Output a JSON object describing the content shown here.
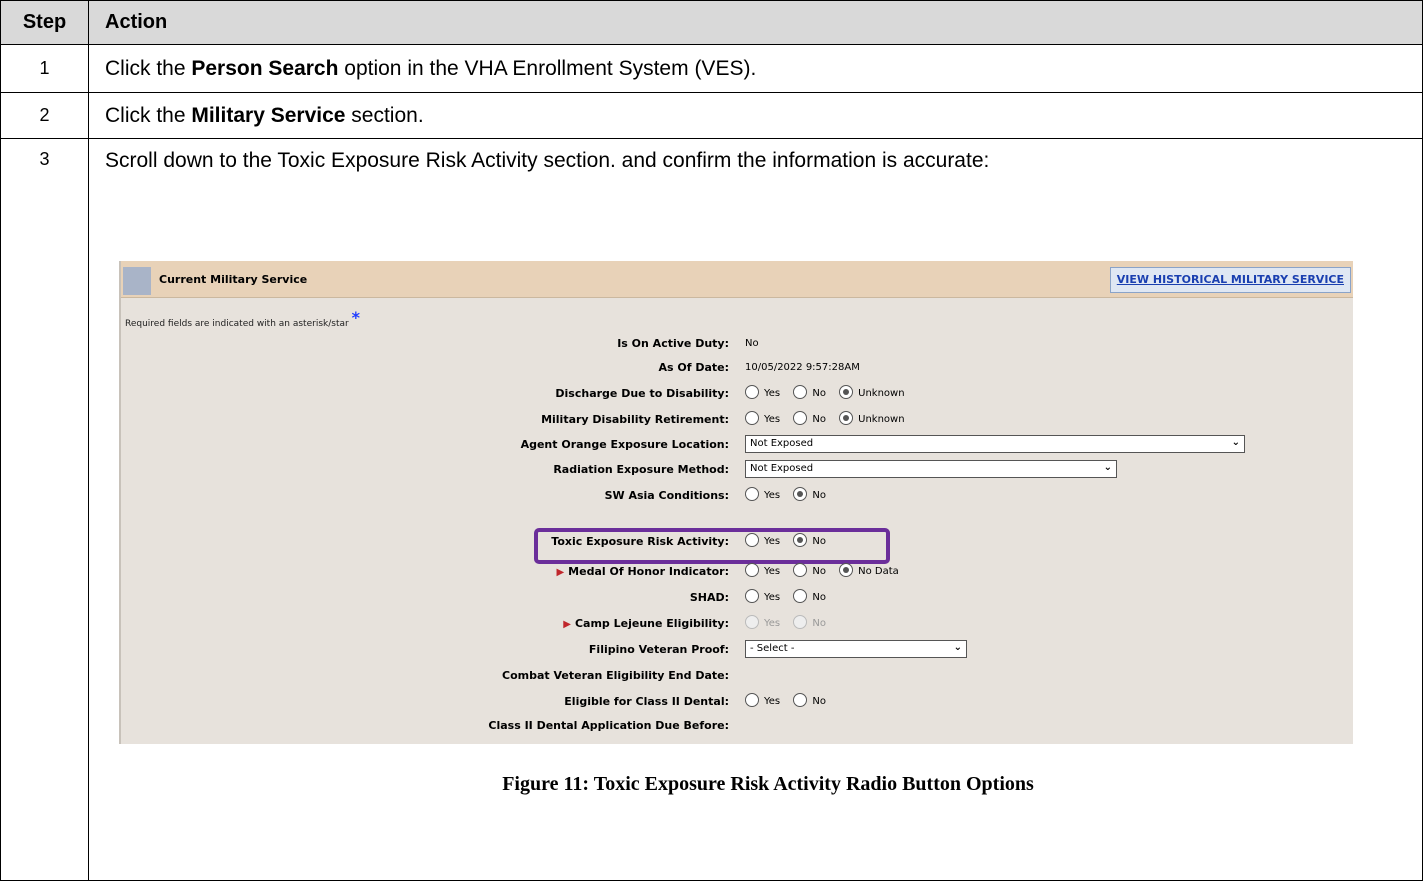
{
  "table": {
    "header_step": "Step",
    "header_action": "Action"
  },
  "rows": [
    {
      "step": "1",
      "pre": "Click the ",
      "bold": "Person Search",
      "post": " option in the VHA Enrollment System (VES)."
    },
    {
      "step": "2",
      "pre": "Click the ",
      "bold": "Military Service",
      "post": " section."
    },
    {
      "step": "3",
      "text": "Scroll down to the Toxic Exposure Risk Activity section. and confirm the information is accurate:"
    }
  ],
  "screenshot": {
    "title": "Current Military Service",
    "link": "VIEW HISTORICAL MILITARY SERVICE",
    "required_note": "Required fields are indicated with an asterisk/star",
    "required_star": "*",
    "fields": {
      "active_duty": {
        "label": "Is On Active Duty:",
        "value": "No"
      },
      "as_of_date": {
        "label": "As Of Date:",
        "value": "10/05/2022 9:57:28AM"
      },
      "discharge": {
        "label": "Discharge Due to Disability:",
        "options": [
          "Yes",
          "No",
          "Unknown"
        ],
        "selected": "Unknown"
      },
      "retirement": {
        "label": "Military Disability Retirement:",
        "options": [
          "Yes",
          "No",
          "Unknown"
        ],
        "selected": "Unknown"
      },
      "agent_orange": {
        "label": "Agent Orange Exposure Location:",
        "value": "Not Exposed"
      },
      "radiation": {
        "label": "Radiation Exposure Method:",
        "value": "Not Exposed"
      },
      "sw_asia": {
        "label": "SW Asia Conditions:",
        "options": [
          "Yes",
          "No"
        ],
        "selected": "No"
      },
      "toxic": {
        "label": "Toxic Exposure Risk Activity:",
        "options": [
          "Yes",
          "No"
        ],
        "selected": "No"
      },
      "medal": {
        "label": "Medal Of Honor Indicator:",
        "options": [
          "Yes",
          "No",
          "No Data"
        ],
        "selected": "No Data"
      },
      "shad": {
        "label": "SHAD:",
        "options": [
          "Yes",
          "No"
        ],
        "selected": ""
      },
      "lejeune": {
        "label": "Camp Lejeune Eligibility:",
        "options": [
          "Yes",
          "No"
        ],
        "selected": ""
      },
      "filipino": {
        "label": "Filipino Veteran Proof:",
        "value": "- Select -"
      },
      "combat_end": {
        "label": "Combat Veteran Eligibility End Date:",
        "value": ""
      },
      "class2": {
        "label": "Eligible for Class II Dental:",
        "options": [
          "Yes",
          "No"
        ],
        "selected": ""
      },
      "class2_due": {
        "label": "Class II Dental Application Due Before:",
        "value": ""
      }
    }
  },
  "caption": "Figure 11: Toxic Exposure Risk Activity Radio Button Options",
  "colors": {
    "header_bg": "#d9d9d9",
    "highlight": "#6b2e9a",
    "link": "#1a3fb0"
  }
}
